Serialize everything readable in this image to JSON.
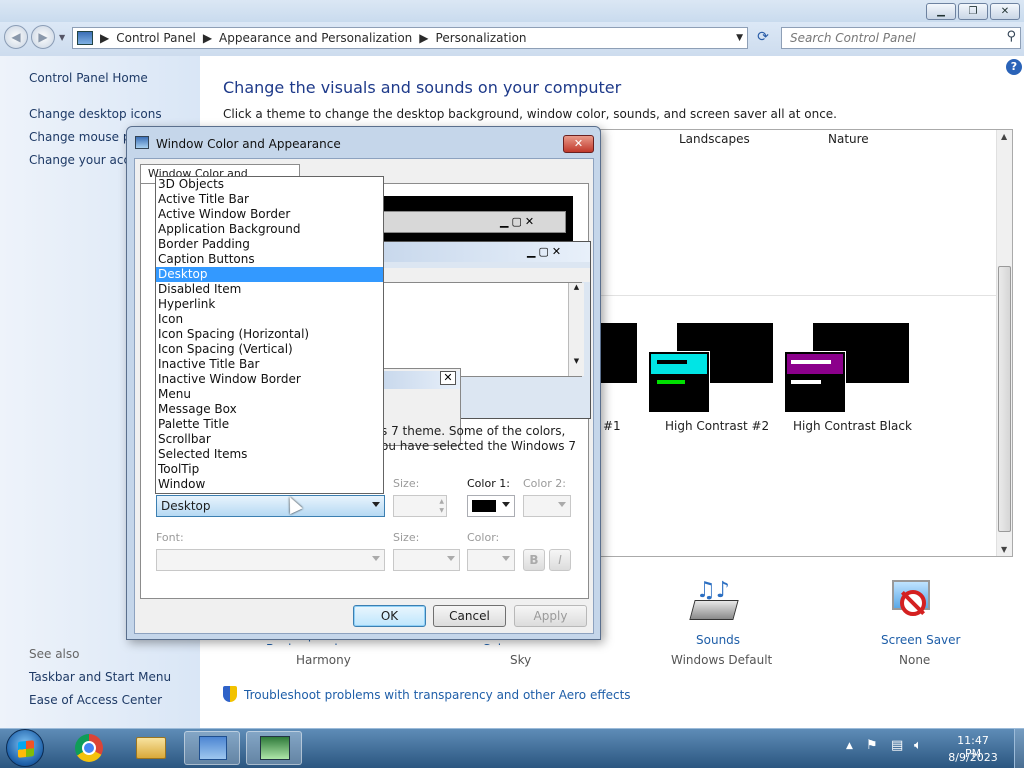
{
  "window": {
    "minimize_label": "▁",
    "maximize_label": "❐",
    "close_label": "✕"
  },
  "address": {
    "crumbs": [
      "Control Panel",
      "Appearance and Personalization",
      "Personalization"
    ],
    "search_placeholder": "Search Control Panel"
  },
  "sidebar": {
    "home": "Control Panel Home",
    "links": [
      "Change desktop icons",
      "Change mouse po",
      "Change your acco"
    ],
    "see_also": "See also",
    "also_links": [
      "Taskbar and Start Menu",
      "Ease of Access Center"
    ]
  },
  "content": {
    "heading": "Change the visuals and sounds on your computer",
    "subtitle": "Click a theme to change the desktop background, window color, sounds, and screen saver all at once.",
    "theme_headers": [
      "Landscapes",
      "Nature"
    ],
    "themes": [
      "#1",
      "High Contrast #2",
      "High Contrast Black"
    ],
    "bottom": [
      {
        "label": "Desktop Background",
        "value": "Harmony"
      },
      {
        "label": "Window Color",
        "value": "Sky"
      },
      {
        "label": "Sounds",
        "value": "Windows Default"
      },
      {
        "label": "Screen Saver",
        "value": "None"
      }
    ],
    "troubleshoot": "Troubleshoot problems with transparency and other Aero effects"
  },
  "dialog": {
    "title": "Window Color and Appearance",
    "tab": "Window Color and Appearance",
    "note_line1": "s 7 theme.  Some of the colors,",
    "note_line2": "ou have selected the Windows 7",
    "item_value": "Desktop",
    "size_label": "Size:",
    "color1_label": "Color 1:",
    "color2_label": "Color 2:",
    "font_label": "Font:",
    "font_size_label": "Size:",
    "font_color_label": "Color:",
    "bold": "B",
    "italic": "I",
    "ok": "OK",
    "cancel": "Cancel",
    "apply": "Apply",
    "items": [
      "3D Objects",
      "Active Title Bar",
      "Active Window Border",
      "Application Background",
      "Border Padding",
      "Caption Buttons",
      "Desktop",
      "Disabled Item",
      "Hyperlink",
      "Icon",
      "Icon Spacing (Horizontal)",
      "Icon Spacing (Vertical)",
      "Inactive Title Bar",
      "Inactive Window Border",
      "Menu",
      "Message Box",
      "Palette Title",
      "Scrollbar",
      "Selected Items",
      "ToolTip",
      "Window"
    ],
    "selected_item": "Desktop",
    "color1": "#000000"
  },
  "taskbar": {
    "time": "11:47 PM",
    "date": "8/9/2023",
    "pinned": [
      "start-orb-icon",
      "chrome-icon",
      "file-explorer-icon",
      "control-panel-icon",
      "personalization-icon"
    ]
  },
  "colors": {
    "accent": "#3399ff",
    "hc2_cyan": "#00e5e5",
    "hc2_green": "#00e000",
    "hcb_purple": "#8b008b"
  }
}
